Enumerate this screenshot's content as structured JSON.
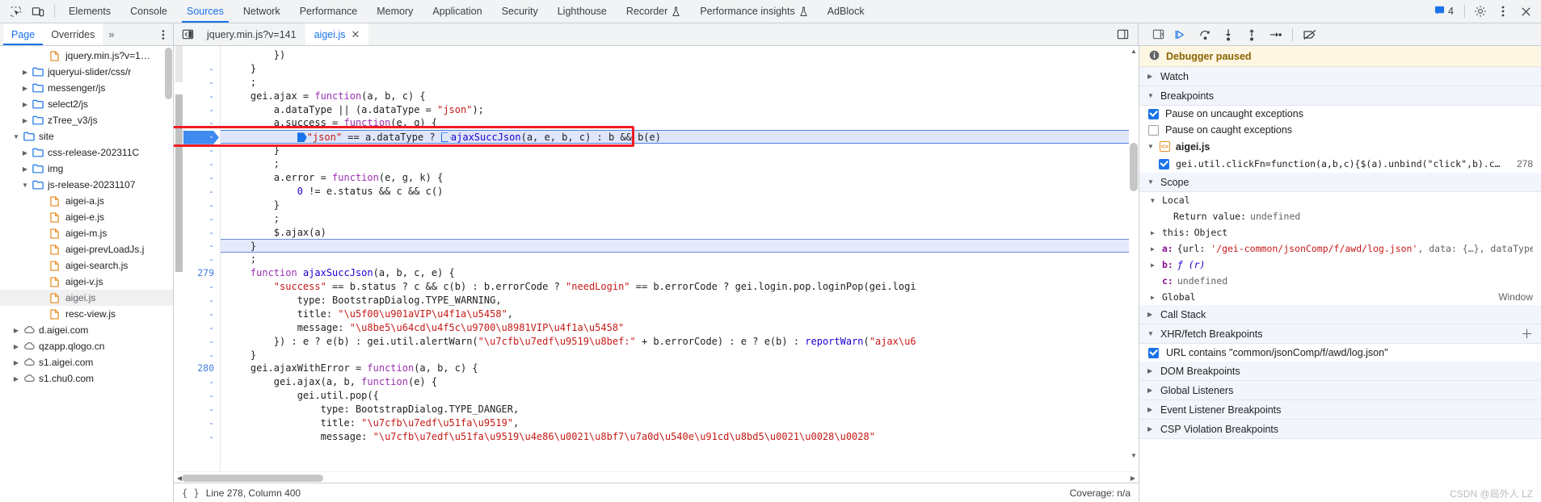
{
  "toolbar": {
    "icons": [
      {
        "name": "inspect-element-icon",
        "glyph": "inspect"
      },
      {
        "name": "device-toolbar-icon",
        "glyph": "device"
      }
    ],
    "tabs": [
      {
        "label": "Elements",
        "active": false,
        "flask": false
      },
      {
        "label": "Console",
        "active": false,
        "flask": false
      },
      {
        "label": "Sources",
        "active": true,
        "flask": false
      },
      {
        "label": "Network",
        "active": false,
        "flask": false
      },
      {
        "label": "Performance",
        "active": false,
        "flask": false
      },
      {
        "label": "Memory",
        "active": false,
        "flask": false
      },
      {
        "label": "Application",
        "active": false,
        "flask": false
      },
      {
        "label": "Security",
        "active": false,
        "flask": false
      },
      {
        "label": "Lighthouse",
        "active": false,
        "flask": false
      },
      {
        "label": "Recorder",
        "active": false,
        "flask": true
      },
      {
        "label": "Performance insights",
        "active": false,
        "flask": true
      },
      {
        "label": "AdBlock",
        "active": false,
        "flask": false
      }
    ],
    "issues_count": "4",
    "settings_icon": "gear-icon",
    "more_icon": "more-vertical-icon",
    "close_icon": "close-icon"
  },
  "nav_subbar": {
    "tabs": [
      {
        "label": "Page",
        "active": true
      },
      {
        "label": "Overrides",
        "active": false
      }
    ],
    "more_label": "»",
    "dots_icon": "more-vertical-icon"
  },
  "editor_subbar": {
    "panel_toggle_icon": "show-navigator-icon",
    "files": [
      {
        "label": "jquery.min.js?v=141",
        "active": false,
        "closeable": false
      },
      {
        "label": "aigei.js",
        "active": true,
        "closeable": true,
        "close": "✕"
      }
    ],
    "right_icon": "split-panel-icon"
  },
  "debug_subbar": {
    "buttons": [
      {
        "name": "pause-on-exceptions-panel-icon",
        "title": "toggle-panel"
      },
      {
        "name": "resume-script-icon",
        "title": "Resume script execution"
      },
      {
        "name": "step-over-icon",
        "title": "Step over next function call"
      },
      {
        "name": "step-into-icon",
        "title": "Step into next function call"
      },
      {
        "name": "step-out-icon",
        "title": "Step out of current function"
      },
      {
        "name": "step-icon",
        "title": "Step"
      },
      {
        "name": "deactivate-breakpoints-icon",
        "title": "Deactivate breakpoints"
      }
    ]
  },
  "file_tree": {
    "nodes": [
      {
        "label": "jquery.min.js?v=1…",
        "indent": 4,
        "type": "file",
        "twisty": "none",
        "selected": false
      },
      {
        "label": "jqueryui-slider/css/r",
        "indent": 2,
        "type": "folder",
        "twisty": "collapsed",
        "selected": false
      },
      {
        "label": "messenger/js",
        "indent": 2,
        "type": "folder",
        "twisty": "collapsed",
        "selected": false
      },
      {
        "label": "select2/js",
        "indent": 2,
        "type": "folder",
        "twisty": "collapsed",
        "selected": false
      },
      {
        "label": "zTree_v3/js",
        "indent": 2,
        "type": "folder",
        "twisty": "collapsed",
        "selected": false
      },
      {
        "label": "site",
        "indent": 1,
        "type": "folder",
        "twisty": "expanded",
        "selected": false
      },
      {
        "label": "css-release-202311C",
        "indent": 2,
        "type": "folder",
        "twisty": "collapsed",
        "selected": false
      },
      {
        "label": "img",
        "indent": 2,
        "type": "folder",
        "twisty": "collapsed",
        "selected": false
      },
      {
        "label": "js-release-20231107",
        "indent": 2,
        "type": "folder",
        "twisty": "expanded",
        "selected": false
      },
      {
        "label": "aigei-a.js",
        "indent": 4,
        "type": "file",
        "twisty": "none",
        "selected": false
      },
      {
        "label": "aigei-e.js",
        "indent": 4,
        "type": "file",
        "twisty": "none",
        "selected": false
      },
      {
        "label": "aigei-m.js",
        "indent": 4,
        "type": "file",
        "twisty": "none",
        "selected": false
      },
      {
        "label": "aigei-prevLoadJs.j",
        "indent": 4,
        "type": "file",
        "twisty": "none",
        "selected": false
      },
      {
        "label": "aigei-search.js",
        "indent": 4,
        "type": "file",
        "twisty": "none",
        "selected": false
      },
      {
        "label": "aigei-v.js",
        "indent": 4,
        "type": "file",
        "twisty": "none",
        "selected": false
      },
      {
        "label": "aigei.js",
        "indent": 4,
        "type": "file",
        "twisty": "none",
        "selected": true
      },
      {
        "label": "resc-view.js",
        "indent": 4,
        "type": "file",
        "twisty": "none",
        "selected": false
      },
      {
        "label": "d.aigei.com",
        "indent": 1,
        "type": "cloud",
        "twisty": "collapsed",
        "selected": false
      },
      {
        "label": "qzapp.qlogo.cn",
        "indent": 1,
        "type": "cloud",
        "twisty": "collapsed",
        "selected": false
      },
      {
        "label": "s1.aigei.com",
        "indent": 1,
        "type": "cloud",
        "twisty": "collapsed",
        "selected": false
      },
      {
        "label": "s1.chu0.com",
        "indent": 1,
        "type": "cloud",
        "twisty": "collapsed",
        "selected": false
      }
    ]
  },
  "editor": {
    "lines": [
      {
        "num": "",
        "text": "        })",
        "state": "normal"
      },
      {
        "num": "-",
        "text": "    }",
        "state": "normal"
      },
      {
        "num": "-",
        "text": "    ;",
        "state": "normal"
      },
      {
        "num": "-",
        "text": "    gei.ajax = function(a, b, c) {",
        "state": "normal"
      },
      {
        "num": "-",
        "text": "        a.dataType || (a.dataType = \"json\");",
        "state": "normal"
      },
      {
        "num": "-",
        "text": "        a.success = function(e, g) {",
        "state": "normal"
      },
      {
        "num": "-",
        "text": "            \"json\" == a.dataType ? ajaxSuccJson(a, e, b, c) : b && b(e)",
        "state": "executing"
      },
      {
        "num": "-",
        "text": "        }",
        "state": "normal"
      },
      {
        "num": "-",
        "text": "        ;",
        "state": "normal"
      },
      {
        "num": "-",
        "text": "        a.error = function(e, g, k) {",
        "state": "normal"
      },
      {
        "num": "-",
        "text": "            0 != e.status && c && c()",
        "state": "normal"
      },
      {
        "num": "-",
        "text": "        }",
        "state": "normal"
      },
      {
        "num": "-",
        "text": "        ;",
        "state": "normal"
      },
      {
        "num": "-",
        "text": "        $.ajax(a)",
        "state": "normal"
      },
      {
        "num": "-",
        "text": "    }",
        "state": "selected"
      },
      {
        "num": "-",
        "text": "    ;",
        "state": "normal"
      },
      {
        "num": "279",
        "text": "    function ajaxSuccJson(a, b, c, e) {",
        "state": "normal"
      },
      {
        "num": "-",
        "text": "        \"success\" == b.status ? c && c(b) : b.errorCode ? \"needLogin\" == b.errorCode ? gei.login.pop.loginPop(gei.logi",
        "state": "normal"
      },
      {
        "num": "-",
        "text": "            type: BootstrapDialog.TYPE_WARNING,",
        "state": "normal"
      },
      {
        "num": "-",
        "text": "            title: \"\\u5f00\\u901aVIP\\u4f1a\\u5458\",",
        "state": "normal"
      },
      {
        "num": "-",
        "text": "            message: \"\\u8be5\\u64cd\\u4f5c\\u9700\\u8981VIP\\u4f1a\\u5458\"",
        "state": "normal"
      },
      {
        "num": "-",
        "text": "        }) : e ? e(b) : gei.util.alertWarn(\"\\u7cfb\\u7edf\\u9519\\u8bef:\" + b.errorCode) : e ? e(b) : reportWarn(\"ajax\\u6",
        "state": "normal"
      },
      {
        "num": "-",
        "text": "    }",
        "state": "normal"
      },
      {
        "num": "280",
        "text": "    gei.ajaxWithError = function(a, b, c) {",
        "state": "normal"
      },
      {
        "num": "-",
        "text": "        gei.ajax(a, b, function(e) {",
        "state": "normal"
      },
      {
        "num": "-",
        "text": "            gei.util.pop({",
        "state": "normal"
      },
      {
        "num": "-",
        "text": "                type: BootstrapDialog.TYPE_DANGER,",
        "state": "normal"
      },
      {
        "num": "-",
        "text": "                title: \"\\u7cfb\\u7edf\\u51fa\\u9519\",",
        "state": "normal"
      },
      {
        "num": "-",
        "text": "                message: \"\\u7cfb\\u7edf\\u51fa\\u9519\\u4e86\\u0021\\u8bf7\\u7a0d\\u540e\\u91cd\\u8bd5\\u0021\\u0028\\u0028\"",
        "state": "normal"
      }
    ]
  },
  "status": {
    "position": "Line 278, Column 400",
    "coverage": "Coverage: n/a",
    "braces_icon": "curly-braces-icon"
  },
  "debugger": {
    "paused_title": "Debugger paused",
    "paused_icon": "info-icon",
    "watch_label": "Watch",
    "breakpoints_label": "Breakpoints",
    "pause_uncaught": {
      "label": "Pause on uncaught exceptions",
      "checked": true
    },
    "pause_caught": {
      "label": "Pause on caught exceptions",
      "checked": false
    },
    "bp_file": "aigei.js",
    "bp_entry": {
      "checked": true,
      "code": "gei.util.clickFn=function(a,b,c){$(a).unbind(\"click\",b).cli…",
      "line": "278"
    },
    "scope_label": "Scope",
    "local_label": "Local",
    "local_rows": [
      {
        "indent": 1,
        "twisty": "none",
        "label": "Return value: ",
        "value": "undefined",
        "value_style": "gray"
      },
      {
        "indent": 0,
        "twisty": "collapsed",
        "label": "this: ",
        "value": "Object",
        "value_style": "plain"
      },
      {
        "indent": 0,
        "twisty": "collapsed",
        "label": "a: ",
        "value": "{url: '/gei-common/jsonComp/f/awd/log.json', data: {…}, dataType:",
        "value_style": "obj",
        "name_bold": true
      },
      {
        "indent": 0,
        "twisty": "collapsed",
        "label": "b: ",
        "value": "ƒ (r)",
        "value_style": "fn",
        "name_bold": true
      },
      {
        "indent": 1,
        "twisty": "none",
        "label": "c: ",
        "value": "undefined",
        "value_style": "gray",
        "name_bold": true
      }
    ],
    "global_label": "Global",
    "global_value": "Window",
    "call_stack_label": "Call Stack",
    "xhr_label": "XHR/fetch Breakpoints",
    "xhr_entry": {
      "label": "URL contains \"common/jsonComp/f/awd/log.json\"",
      "checked": true
    },
    "dom_bp_label": "DOM Breakpoints",
    "global_listeners_label": "Global Listeners",
    "event_listener_bp_label": "Event Listener Breakpoints",
    "csp_label": "CSP Violation Breakpoints"
  },
  "watermark": "CSDN @局外人 LZ",
  "colors": {
    "accent": "#1a73e8",
    "toolbar_bg": "#f1f3f4",
    "paused_bg": "#fdf6e3",
    "redbox": "#ee1c22",
    "string": "#c41a16",
    "keyword": "#9b30b3",
    "number": "#1c00cf"
  }
}
